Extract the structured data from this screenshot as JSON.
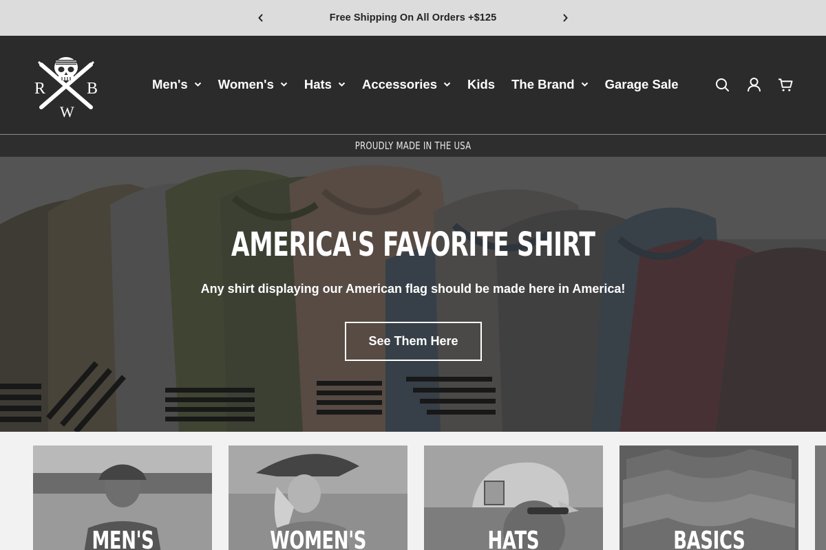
{
  "announcement": {
    "message": "Free Shipping On All Orders +$125",
    "prev_icon": "chevron-left-icon",
    "next_icon": "chevron-right-icon"
  },
  "header": {
    "logo_letters": [
      "R",
      "B",
      "W"
    ],
    "nav": [
      {
        "label": "Men's",
        "has_dropdown": true
      },
      {
        "label": "Women's",
        "has_dropdown": true
      },
      {
        "label": "Hats",
        "has_dropdown": true
      },
      {
        "label": "Accessories",
        "has_dropdown": true
      },
      {
        "label": "Kids",
        "has_dropdown": false
      },
      {
        "label": "The Brand",
        "has_dropdown": true
      },
      {
        "label": "Garage Sale",
        "has_dropdown": false
      }
    ],
    "icons": [
      "search-icon",
      "account-icon",
      "cart-icon"
    ]
  },
  "usa_bar": {
    "text": "PROUDLY MADE IN THE USA"
  },
  "hero": {
    "title": "AMERICA'S FAVORITE SHIRT",
    "subtitle": "Any shirt displaying our American flag should be made here in America!",
    "button_label": "See Them Here"
  },
  "categories": [
    {
      "label": "MEN'S"
    },
    {
      "label": "WOMEN'S"
    },
    {
      "label": "HATS"
    },
    {
      "label": "BASICS"
    }
  ],
  "colors": {
    "header_bg": "#2b2b2b",
    "announcement_bg": "#dcdcdc",
    "page_bg": "#f2f2f2",
    "text_light": "#ffffff"
  }
}
